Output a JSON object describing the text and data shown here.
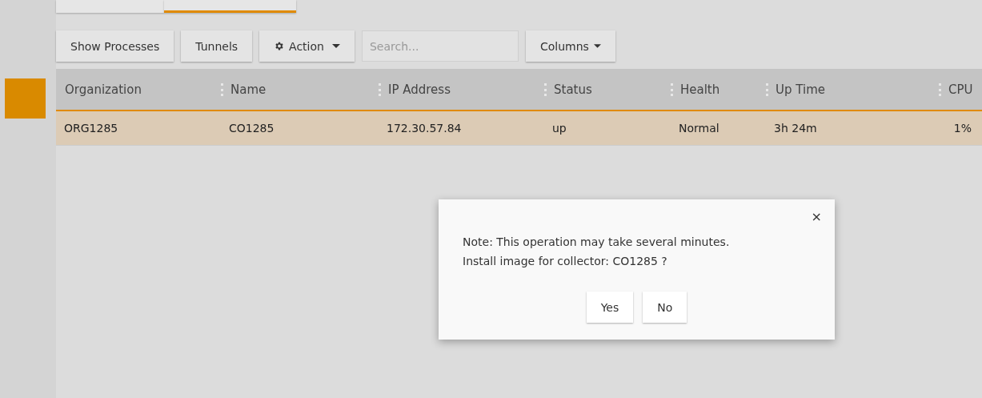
{
  "tabs": [
    {
      "selected": false
    },
    {
      "selected": true
    }
  ],
  "toolbar": {
    "buttons": [
      {
        "kind": "plain",
        "label": "Show Processes"
      },
      {
        "kind": "plain",
        "label": "Tunnels"
      },
      {
        "kind": "gear-menu",
        "label": "Action"
      }
    ],
    "search": {
      "placeholder": "Search..."
    },
    "columns_button": {
      "label": "Columns"
    }
  },
  "table": {
    "columns": [
      "Organization",
      "Name",
      "IP Address",
      "Status",
      "Health",
      "Up Time",
      "CPU"
    ],
    "rows": [
      {
        "selected": true,
        "cells": [
          "ORG1285",
          "CO1285",
          "172.30.57.84",
          "up",
          "Normal",
          "3h 24m",
          "1%"
        ]
      }
    ]
  },
  "dialog": {
    "message": "Note: This operation may take several minutes.\nInstall image for collector: CO1285 ?",
    "close": "×",
    "buttons": [
      "Yes",
      "No"
    ]
  }
}
